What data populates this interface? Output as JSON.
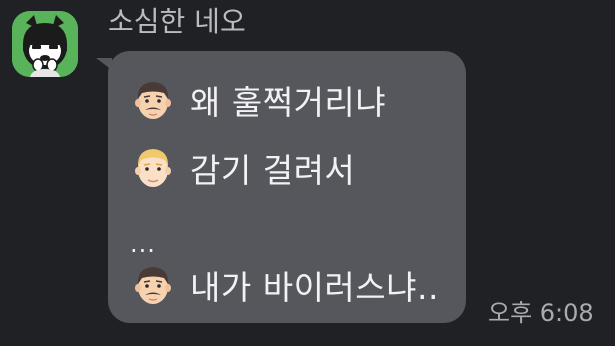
{
  "message": {
    "sender_name": "소심한 네오",
    "avatar_icon": "neo-character-avatar",
    "lines": [
      {
        "emoji": "man-emoji",
        "text": "왜 훌쩍거리냐"
      },
      {
        "emoji": "blond-man-emoji",
        "text": "감기 걸려서"
      },
      {
        "emoji": "",
        "text": "..."
      },
      {
        "emoji": "man-emoji",
        "text": "내가 바이러스냐.."
      }
    ],
    "timestamp": "오후 6:08"
  },
  "colors": {
    "background": "#202124",
    "bubble": "#55575d",
    "avatar_bg": "#58b35a",
    "text": "#f2f2f4",
    "meta_text": "#b9bbc0"
  }
}
